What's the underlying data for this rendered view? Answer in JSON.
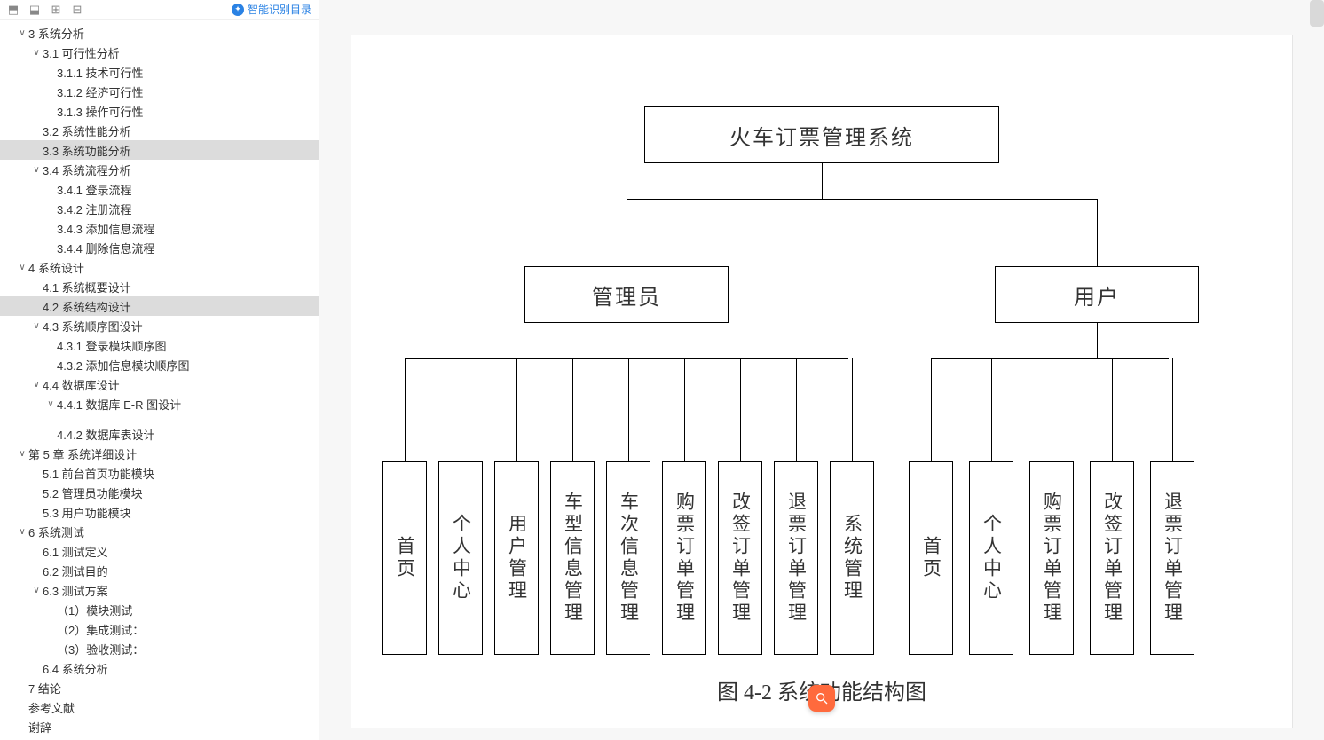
{
  "smart_toc_label": "智能识别目录",
  "toc": [
    {
      "level": 0,
      "toggle": "v",
      "label": "3  系统分析"
    },
    {
      "level": 1,
      "toggle": "v",
      "label": "3.1  可行性分析"
    },
    {
      "level": 2,
      "toggle": "",
      "label": "3.1.1  技术可行性"
    },
    {
      "level": 2,
      "toggle": "",
      "label": "3.1.2 经济可行性"
    },
    {
      "level": 2,
      "toggle": "",
      "label": "3.1.3  操作可行性"
    },
    {
      "level": 1,
      "toggle": "",
      "label": "3.2  系统性能分析"
    },
    {
      "level": 1,
      "toggle": "",
      "label": "3.3  系统功能分析",
      "selected": true
    },
    {
      "level": 1,
      "toggle": "v",
      "label": "3.4  系统流程分析"
    },
    {
      "level": 2,
      "toggle": "",
      "label": "3.4.1  登录流程"
    },
    {
      "level": 2,
      "toggle": "",
      "label": "3.4.2  注册流程"
    },
    {
      "level": 2,
      "toggle": "",
      "label": "3.4.3  添加信息流程"
    },
    {
      "level": 2,
      "toggle": "",
      "label": "3.4.4  删除信息流程"
    },
    {
      "level": 0,
      "toggle": "v",
      "label": "4    系统设计"
    },
    {
      "level": 1,
      "toggle": "",
      "label": "4.1  系统概要设计"
    },
    {
      "level": 1,
      "toggle": "",
      "label": "4.2  系统结构设计",
      "selected": true
    },
    {
      "level": 1,
      "toggle": "v",
      "label": "4.3  系统顺序图设计"
    },
    {
      "level": 2,
      "toggle": "",
      "label": "4.3.1  登录模块顺序图"
    },
    {
      "level": 2,
      "toggle": "",
      "label": "4.3.2  添加信息模块顺序图"
    },
    {
      "level": 1,
      "toggle": "v",
      "label": "4.4  数据库设计"
    },
    {
      "level": 2,
      "toggle": "v",
      "label": "4.4.1  数据库 E-R 图设计"
    },
    {
      "spacer": true
    },
    {
      "level": 2,
      "toggle": "",
      "label": "4.4.2  数据库表设计"
    },
    {
      "level": 0,
      "toggle": "v",
      "label": "第 5 章  系统详细设计"
    },
    {
      "level": 1,
      "toggle": "",
      "label": "5.1  前台首页功能模块"
    },
    {
      "level": 1,
      "toggle": "",
      "label": "5.2  管理员功能模块"
    },
    {
      "level": 1,
      "toggle": "",
      "label": "5.3  用户功能模块"
    },
    {
      "level": 0,
      "toggle": "v",
      "label": "6  系统测试"
    },
    {
      "level": 1,
      "toggle": "",
      "label": "6.1  测试定义"
    },
    {
      "level": 1,
      "toggle": "",
      "label": "6.2  测试目的"
    },
    {
      "level": 1,
      "toggle": "v",
      "label": "6.3  测试方案"
    },
    {
      "level": 2,
      "toggle": "",
      "label": "（1）模块测试"
    },
    {
      "level": 2,
      "toggle": "",
      "label": "（2）集成测试："
    },
    {
      "level": 2,
      "toggle": "",
      "label": "（3）验收测试："
    },
    {
      "level": 1,
      "toggle": "",
      "label": "6.4  系统分析"
    },
    {
      "level": 0,
      "toggle": "",
      "label": "7  结论"
    },
    {
      "level": 0,
      "toggle": "",
      "label": " 参考文献"
    },
    {
      "level": 0,
      "toggle": "",
      "label": " 谢辞"
    }
  ],
  "diagram": {
    "root": "火车订票管理系统",
    "mid": [
      "管理员",
      "用户"
    ],
    "admin": [
      "首页",
      "个人中心",
      "用户管理",
      "车型信息管理",
      "车次信息管理",
      "购票订单管理",
      "改签订单管理",
      "退票订单管理",
      "系统管理"
    ],
    "user": [
      "首页",
      "个人中心",
      "购票订单管理",
      "改签订单管理",
      "退票订单管理"
    ],
    "caption": "图 4-2  系统功能结构图"
  }
}
